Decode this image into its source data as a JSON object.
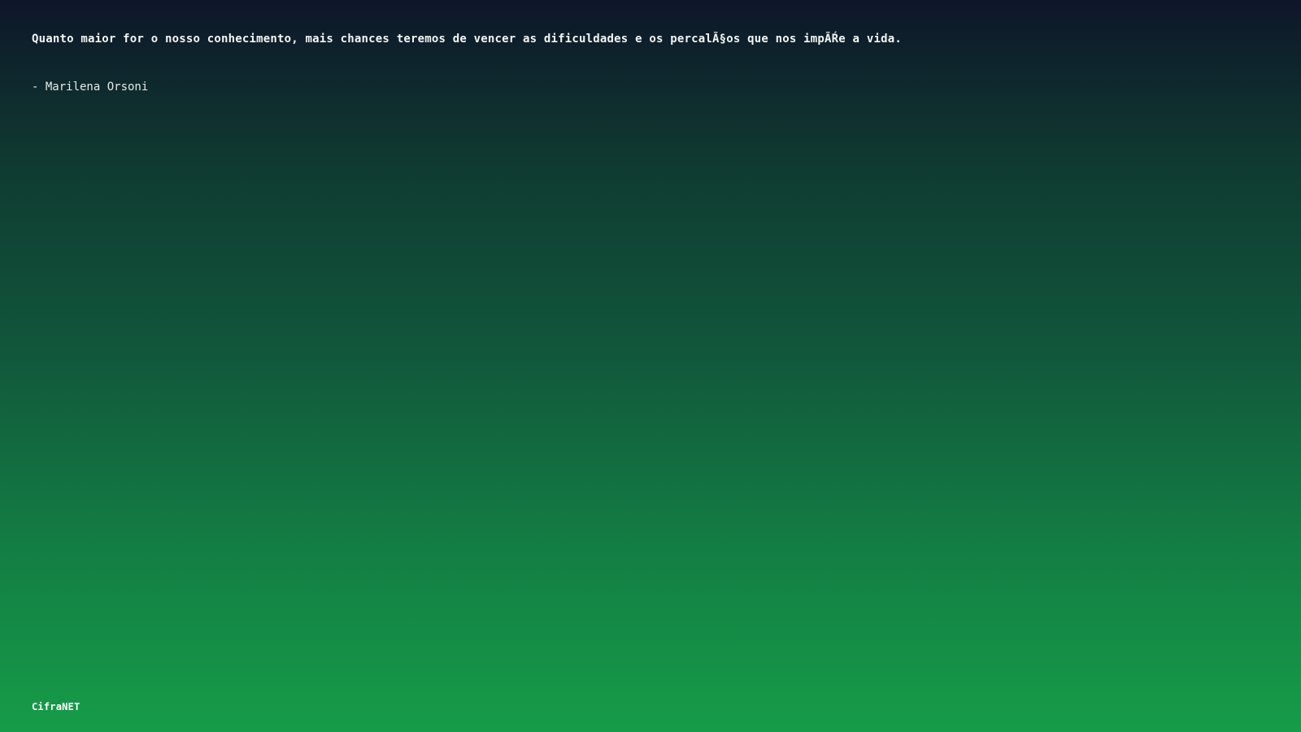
{
  "quote": {
    "text": "Quanto maior for o nosso conhecimento, mais chances teremos de vencer as dificuldades e os percalÃ§os que nos impÃŔe a vida.",
    "author": "- Marilena Orsoni"
  },
  "brand": {
    "name": "CifraNET"
  },
  "colors": {
    "gradient_top": "#0e1629",
    "gradient_bottom": "#169c48",
    "text": "#f2f5f3"
  }
}
